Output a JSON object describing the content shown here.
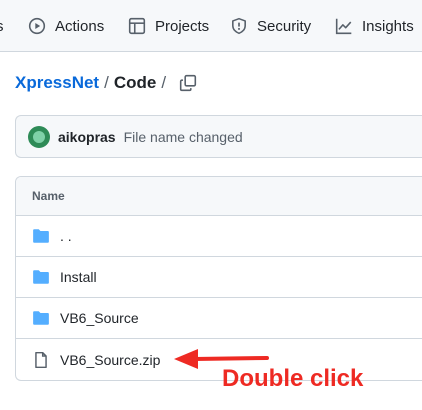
{
  "nav": {
    "tabs": [
      {
        "label": "s",
        "icon": "truncated-tab"
      },
      {
        "label": "Actions",
        "icon": "play-circle-icon"
      },
      {
        "label": "Projects",
        "icon": "table-icon"
      },
      {
        "label": "Security",
        "icon": "shield-icon"
      },
      {
        "label": "Insights",
        "icon": "graph-icon"
      }
    ]
  },
  "breadcrumb": {
    "repo": "XpressNet",
    "sep1": "/",
    "current": "Code",
    "sep2": "/"
  },
  "commit": {
    "author": "aikopras",
    "message": "File name changed"
  },
  "files": {
    "header": "Name",
    "rows": [
      {
        "name": ". .",
        "type": "folder"
      },
      {
        "name": "Install",
        "type": "folder"
      },
      {
        "name": "VB6_Source",
        "type": "folder"
      },
      {
        "name": "VB6_Source.zip",
        "type": "file"
      }
    ]
  },
  "annotation": {
    "text": "Double click",
    "color": "#ee2a23"
  },
  "colors": {
    "link": "#0969da",
    "folder": "#54aeff",
    "border": "#d0d7de"
  }
}
